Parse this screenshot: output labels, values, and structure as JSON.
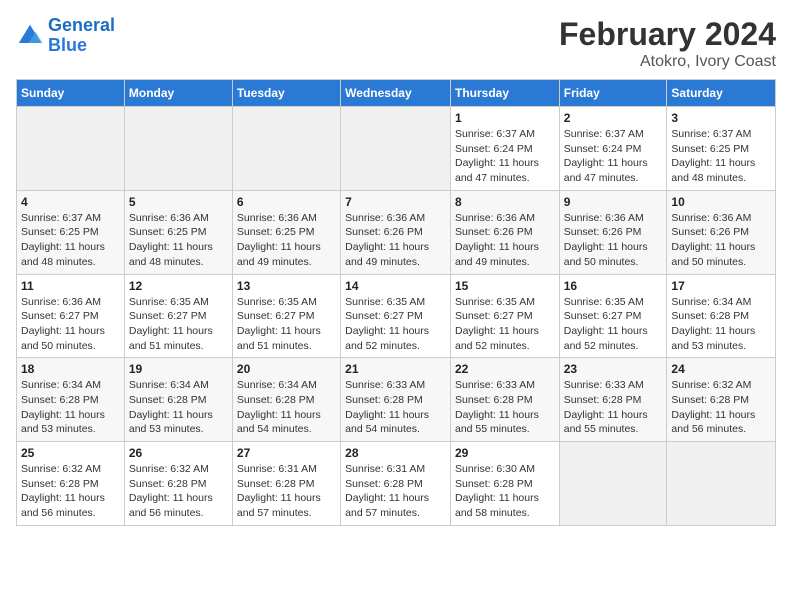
{
  "header": {
    "logo_line1": "General",
    "logo_line2": "Blue",
    "title": "February 2024",
    "subtitle": "Atokro, Ivory Coast"
  },
  "weekdays": [
    "Sunday",
    "Monday",
    "Tuesday",
    "Wednesday",
    "Thursday",
    "Friday",
    "Saturday"
  ],
  "weeks": [
    [
      {
        "day": "",
        "info": ""
      },
      {
        "day": "",
        "info": ""
      },
      {
        "day": "",
        "info": ""
      },
      {
        "day": "",
        "info": ""
      },
      {
        "day": "1",
        "info": "Sunrise: 6:37 AM\nSunset: 6:24 PM\nDaylight: 11 hours and 47 minutes."
      },
      {
        "day": "2",
        "info": "Sunrise: 6:37 AM\nSunset: 6:24 PM\nDaylight: 11 hours and 47 minutes."
      },
      {
        "day": "3",
        "info": "Sunrise: 6:37 AM\nSunset: 6:25 PM\nDaylight: 11 hours and 48 minutes."
      }
    ],
    [
      {
        "day": "4",
        "info": "Sunrise: 6:37 AM\nSunset: 6:25 PM\nDaylight: 11 hours and 48 minutes."
      },
      {
        "day": "5",
        "info": "Sunrise: 6:36 AM\nSunset: 6:25 PM\nDaylight: 11 hours and 48 minutes."
      },
      {
        "day": "6",
        "info": "Sunrise: 6:36 AM\nSunset: 6:25 PM\nDaylight: 11 hours and 49 minutes."
      },
      {
        "day": "7",
        "info": "Sunrise: 6:36 AM\nSunset: 6:26 PM\nDaylight: 11 hours and 49 minutes."
      },
      {
        "day": "8",
        "info": "Sunrise: 6:36 AM\nSunset: 6:26 PM\nDaylight: 11 hours and 49 minutes."
      },
      {
        "day": "9",
        "info": "Sunrise: 6:36 AM\nSunset: 6:26 PM\nDaylight: 11 hours and 50 minutes."
      },
      {
        "day": "10",
        "info": "Sunrise: 6:36 AM\nSunset: 6:26 PM\nDaylight: 11 hours and 50 minutes."
      }
    ],
    [
      {
        "day": "11",
        "info": "Sunrise: 6:36 AM\nSunset: 6:27 PM\nDaylight: 11 hours and 50 minutes."
      },
      {
        "day": "12",
        "info": "Sunrise: 6:35 AM\nSunset: 6:27 PM\nDaylight: 11 hours and 51 minutes."
      },
      {
        "day": "13",
        "info": "Sunrise: 6:35 AM\nSunset: 6:27 PM\nDaylight: 11 hours and 51 minutes."
      },
      {
        "day": "14",
        "info": "Sunrise: 6:35 AM\nSunset: 6:27 PM\nDaylight: 11 hours and 52 minutes."
      },
      {
        "day": "15",
        "info": "Sunrise: 6:35 AM\nSunset: 6:27 PM\nDaylight: 11 hours and 52 minutes."
      },
      {
        "day": "16",
        "info": "Sunrise: 6:35 AM\nSunset: 6:27 PM\nDaylight: 11 hours and 52 minutes."
      },
      {
        "day": "17",
        "info": "Sunrise: 6:34 AM\nSunset: 6:28 PM\nDaylight: 11 hours and 53 minutes."
      }
    ],
    [
      {
        "day": "18",
        "info": "Sunrise: 6:34 AM\nSunset: 6:28 PM\nDaylight: 11 hours and 53 minutes."
      },
      {
        "day": "19",
        "info": "Sunrise: 6:34 AM\nSunset: 6:28 PM\nDaylight: 11 hours and 53 minutes."
      },
      {
        "day": "20",
        "info": "Sunrise: 6:34 AM\nSunset: 6:28 PM\nDaylight: 11 hours and 54 minutes."
      },
      {
        "day": "21",
        "info": "Sunrise: 6:33 AM\nSunset: 6:28 PM\nDaylight: 11 hours and 54 minutes."
      },
      {
        "day": "22",
        "info": "Sunrise: 6:33 AM\nSunset: 6:28 PM\nDaylight: 11 hours and 55 minutes."
      },
      {
        "day": "23",
        "info": "Sunrise: 6:33 AM\nSunset: 6:28 PM\nDaylight: 11 hours and 55 minutes."
      },
      {
        "day": "24",
        "info": "Sunrise: 6:32 AM\nSunset: 6:28 PM\nDaylight: 11 hours and 56 minutes."
      }
    ],
    [
      {
        "day": "25",
        "info": "Sunrise: 6:32 AM\nSunset: 6:28 PM\nDaylight: 11 hours and 56 minutes."
      },
      {
        "day": "26",
        "info": "Sunrise: 6:32 AM\nSunset: 6:28 PM\nDaylight: 11 hours and 56 minutes."
      },
      {
        "day": "27",
        "info": "Sunrise: 6:31 AM\nSunset: 6:28 PM\nDaylight: 11 hours and 57 minutes."
      },
      {
        "day": "28",
        "info": "Sunrise: 6:31 AM\nSunset: 6:28 PM\nDaylight: 11 hours and 57 minutes."
      },
      {
        "day": "29",
        "info": "Sunrise: 6:30 AM\nSunset: 6:28 PM\nDaylight: 11 hours and 58 minutes."
      },
      {
        "day": "",
        "info": ""
      },
      {
        "day": "",
        "info": ""
      }
    ]
  ]
}
